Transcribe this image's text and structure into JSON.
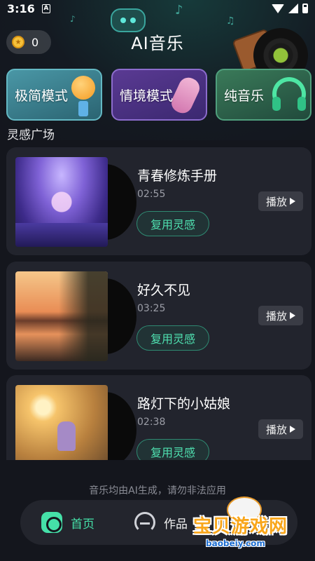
{
  "status_bar": {
    "time": "3:16",
    "notification": "A"
  },
  "header": {
    "title": "AI音乐",
    "coins": "0"
  },
  "modes": [
    {
      "label": "极简模式",
      "icon": "microphone-icon"
    },
    {
      "label": "情境模式",
      "icon": "violin-icon"
    },
    {
      "label": "纯音乐",
      "icon": "headphones-icon"
    }
  ],
  "section": {
    "title": "灵感广场"
  },
  "tracks": [
    {
      "title": "青春修炼手册",
      "duration": "02:55",
      "reuse_label": "复用灵感",
      "play_label": "播放"
    },
    {
      "title": "好久不见",
      "duration": "03:25",
      "reuse_label": "复用灵感",
      "play_label": "播放"
    },
    {
      "title": "路灯下的小姑娘",
      "duration": "02:38",
      "reuse_label": "复用灵感",
      "play_label": "播放"
    }
  ],
  "disclaimer": "音乐均由AI生成，请勿非法应用",
  "nav": {
    "home": "首页",
    "works": "作品"
  },
  "watermark": {
    "text": "宝贝游戏网",
    "url": "baobeiy.com"
  },
  "colors": {
    "accent": "#45e0a8",
    "background": "#14161d",
    "card": "#22242d"
  }
}
